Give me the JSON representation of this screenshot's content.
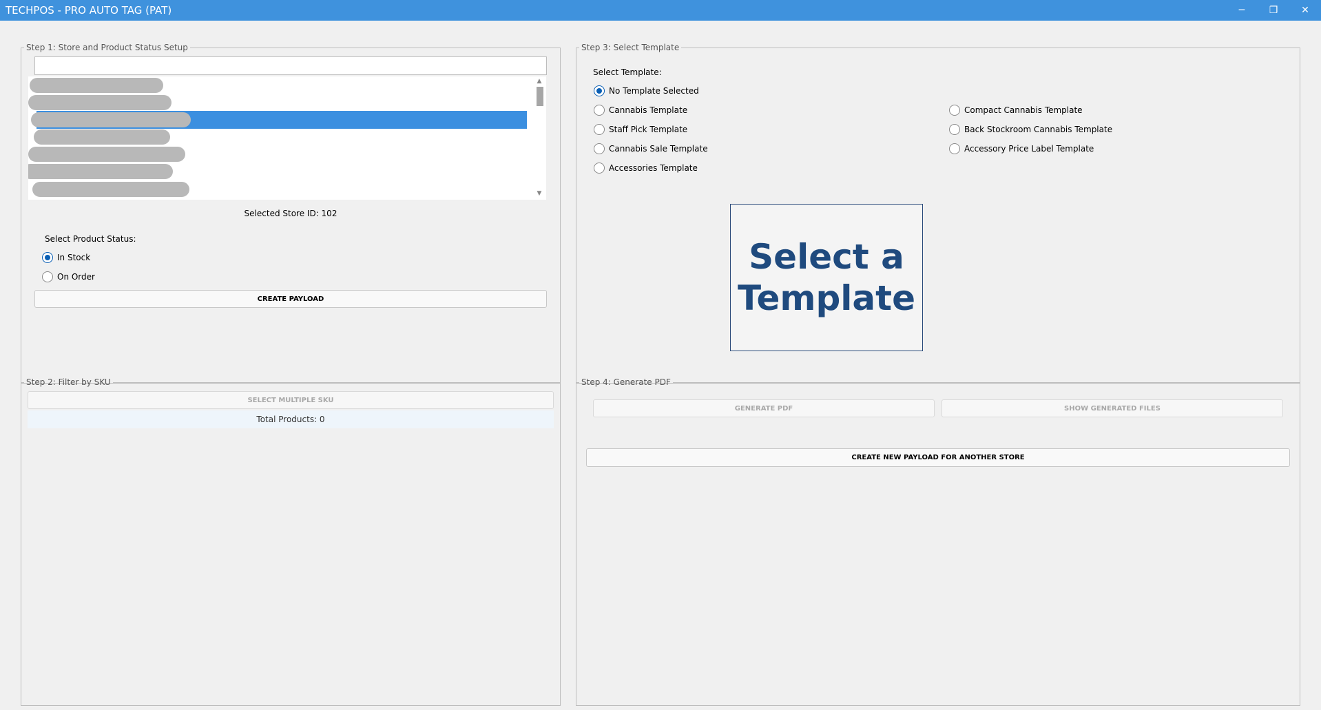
{
  "window": {
    "title": "TECHPOS - PRO AUTO TAG (PAT)",
    "minimize_glyph": "─",
    "restore_glyph": "❐",
    "close_glyph": "✕"
  },
  "step1": {
    "legend": "Step 1: Store and Product Status Setup",
    "search_value": "",
    "store_list_item_count_visible": 7,
    "selected_store_label": "Selected Store ID: 102",
    "product_status_label": "Select Product Status:",
    "status_options": [
      {
        "label": "In Stock",
        "checked": true
      },
      {
        "label": "On Order",
        "checked": false
      }
    ],
    "create_payload_label": "CREATE PAYLOAD"
  },
  "step2": {
    "legend": "Step 2: Filter by SKU",
    "select_multiple_label": "SELECT MULTIPLE SKU",
    "total_products_label": "Total Products: 0"
  },
  "step3": {
    "legend": "Step 3: Select Template",
    "select_template_label": "Select Template:",
    "templates": [
      {
        "label": "No Template Selected",
        "checked": true
      },
      {
        "label": "Cannabis Template",
        "checked": false
      },
      {
        "label": "Staff Pick Template",
        "checked": false
      },
      {
        "label": "Cannabis Sale Template",
        "checked": false
      },
      {
        "label": "Accessories Template",
        "checked": false
      },
      {
        "label": "Compact Cannabis Template",
        "checked": false
      },
      {
        "label": "Back Stockroom Cannabis Template",
        "checked": false
      },
      {
        "label": "Accessory Price Label Template",
        "checked": false
      }
    ],
    "preview_line1": "Select a",
    "preview_line2": "Template"
  },
  "step4": {
    "legend": "Step 4: Generate PDF",
    "generate_pdf_label": "GENERATE PDF",
    "show_files_label": "SHOW GENERATED FILES",
    "new_payload_label": "CREATE NEW PAYLOAD FOR ANOTHER STORE"
  },
  "colors": {
    "titlebar": "#3f92dd",
    "selection": "#3b8fe0",
    "radio_accent": "#0a5fb4",
    "preview_text": "#1f4a7e"
  }
}
